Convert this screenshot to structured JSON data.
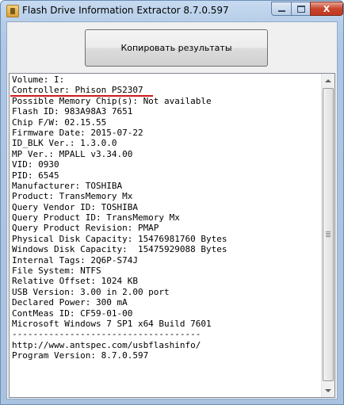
{
  "window": {
    "title": "Flash Drive Information Extractor 8.7.0.597",
    "controls": {
      "minimize": "minimize",
      "maximize": "maximize",
      "close": "X"
    }
  },
  "toolbar": {
    "copy_label": "Копировать результаты"
  },
  "report": {
    "highlight_color": "#d01818",
    "lines": [
      "Volume: I:",
      "Controller: Phison PS2307",
      "Possible Memory Chip(s): Not available",
      "Flash ID: 983A98A3 7651",
      "Chip F/W: 02.15.55",
      "Firmware Date: 2015-07-22",
      "ID_BLK Ver.: 1.3.0.0",
      "MP Ver.: MPALL v3.34.00",
      "VID: 0930",
      "PID: 6545",
      "Manufacturer: TOSHIBA",
      "Product: TransMemory Mx",
      "Query Vendor ID: TOSHIBA",
      "Query Product ID: TransMemory Mx",
      "Query Product Revision: PMAP",
      "Physical Disk Capacity: 15476981760 Bytes",
      "Windows Disk Capacity:  15475929088 Bytes",
      "Internal Tags: 2Q6P-S74J",
      "File System: NTFS",
      "Relative Offset: 1024 KB",
      "USB Version: 3.00 in 2.00 port",
      "Declared Power: 300 mA",
      "ContMeas ID: CF59-01-00",
      "Microsoft Windows 7 SP1 x64 Build 7601",
      "------------------------------------",
      "http://www.antspec.com/usbflashinfo/",
      "Program Version: 8.7.0.597"
    ]
  }
}
